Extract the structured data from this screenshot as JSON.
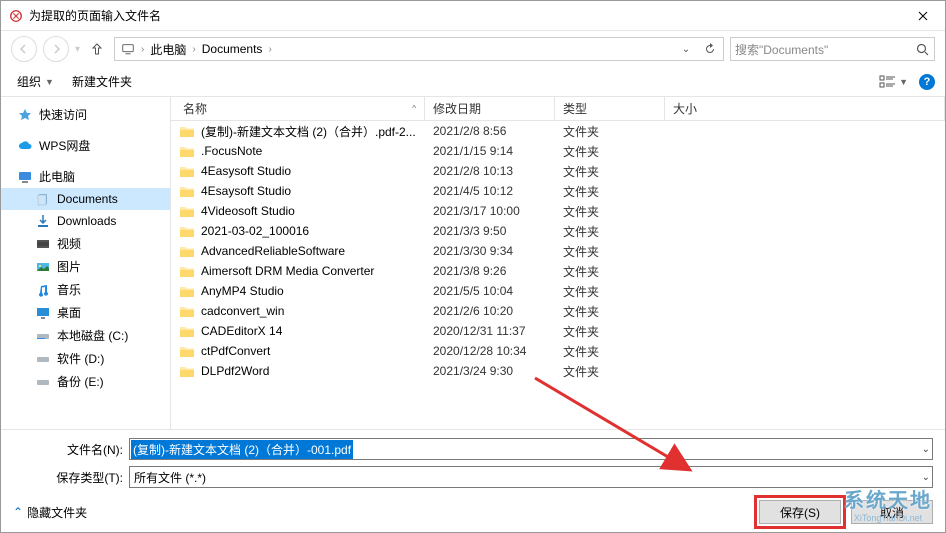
{
  "window": {
    "title": "为提取的页面输入文件名"
  },
  "address": {
    "segments": [
      "此电脑",
      "Documents"
    ],
    "search_placeholder": "搜索\"Documents\""
  },
  "toolbar": {
    "organize": "组织",
    "newfolder": "新建文件夹"
  },
  "sidebar": {
    "quick": "快速访问",
    "wps": "WPS网盘",
    "thispc": "此电脑",
    "thispc_children": [
      "Documents",
      "Downloads",
      "视频",
      "图片",
      "音乐",
      "桌面",
      "本地磁盘 (C:)",
      "软件 (D:)",
      "备份 (E:)"
    ]
  },
  "columns": {
    "name": "名称",
    "date": "修改日期",
    "type": "类型",
    "size": "大小"
  },
  "rows": [
    {
      "name": "(复制)-新建文本文档 (2)（合并）.pdf-2...",
      "date": "2021/2/8 8:56",
      "type": "文件夹"
    },
    {
      "name": ".FocusNote",
      "date": "2021/1/15 9:14",
      "type": "文件夹"
    },
    {
      "name": "4Easysoft Studio",
      "date": "2021/2/8 10:13",
      "type": "文件夹"
    },
    {
      "name": "4Esaysoft Studio",
      "date": "2021/4/5 10:12",
      "type": "文件夹"
    },
    {
      "name": "4Videosoft Studio",
      "date": "2021/3/17 10:00",
      "type": "文件夹"
    },
    {
      "name": "2021-03-02_100016",
      "date": "2021/3/3 9:50",
      "type": "文件夹"
    },
    {
      "name": "AdvancedReliableSoftware",
      "date": "2021/3/30 9:34",
      "type": "文件夹"
    },
    {
      "name": "Aimersoft DRM Media Converter",
      "date": "2021/3/8 9:26",
      "type": "文件夹"
    },
    {
      "name": "AnyMP4 Studio",
      "date": "2021/5/5 10:04",
      "type": "文件夹"
    },
    {
      "name": "cadconvert_win",
      "date": "2021/2/6 10:20",
      "type": "文件夹"
    },
    {
      "name": "CADEditorX 14",
      "date": "2020/12/31 11:37",
      "type": "文件夹"
    },
    {
      "name": "ctPdfConvert",
      "date": "2020/12/28 10:34",
      "type": "文件夹"
    },
    {
      "name": "DLPdf2Word",
      "date": "2021/3/24 9:30",
      "type": "文件夹"
    }
  ],
  "form": {
    "filename_label": "文件名(N):",
    "filename_value": "(复制)-新建文本文档 (2)（合并）-001.pdf",
    "savetype_label": "保存类型(T):",
    "savetype_value": "所有文件 (*.*)"
  },
  "buttons": {
    "hide_folders": "隐藏文件夹",
    "save": "保存(S)",
    "cancel": "取消"
  },
  "logo": {
    "cn": "系统天地",
    "py": "XiTongTianDi.net"
  }
}
